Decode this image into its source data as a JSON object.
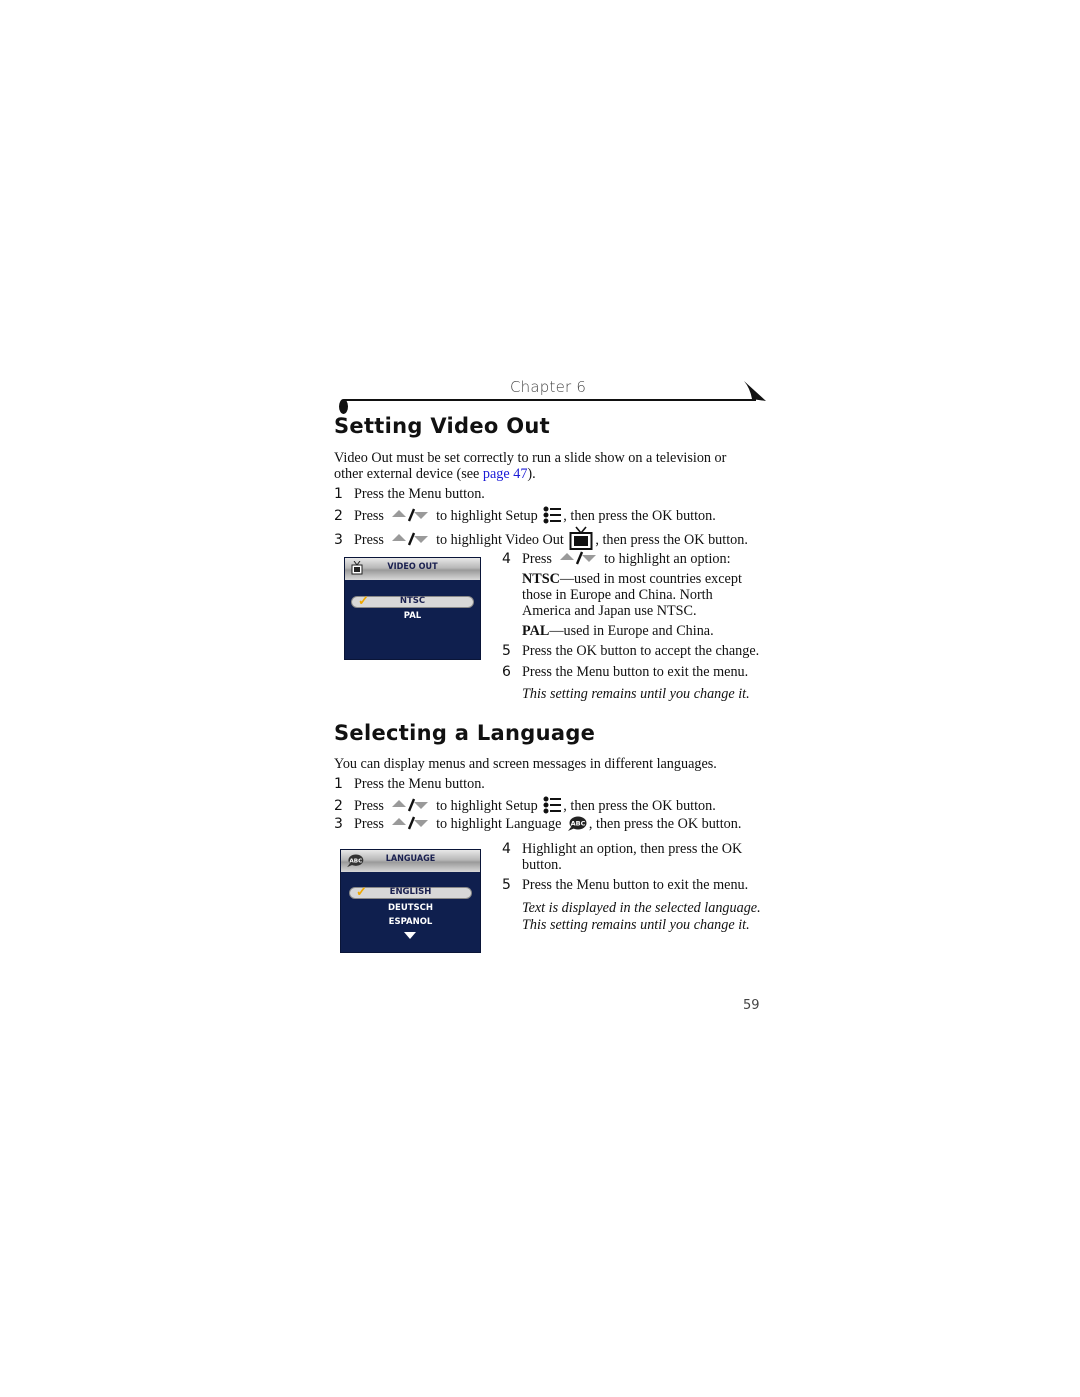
{
  "header": {
    "chapter": "Chapter 6"
  },
  "section1": {
    "title": "Setting Video Out",
    "intro_pre": "Video Out must be set correctly to run a slide show on a television or other external device (see ",
    "intro_link": "page 47",
    "intro_post": ").",
    "steps": [
      {
        "num": "1",
        "text": "Press the Menu button."
      },
      {
        "num": "2",
        "pre": "Press",
        "mid": "to highlight Setup",
        "post": ", then press the OK button."
      },
      {
        "num": "3",
        "pre": "Press",
        "mid": "to highlight Video Out",
        "post": ", then press the OK button."
      },
      {
        "num": "4",
        "pre": "Press",
        "mid": "to highlight an option:"
      },
      {
        "num": "5",
        "text": "Press the OK button to accept the change."
      },
      {
        "num": "6",
        "text": "Press the Menu button to exit the menu."
      }
    ],
    "options": [
      {
        "name": "NTSC",
        "desc": "—used in most countries except those in Europe and China. North America and Japan use NTSC."
      },
      {
        "name": "PAL",
        "desc": "—used in Europe and China."
      }
    ],
    "note": "This setting remains until you change it.",
    "screen": {
      "title": "VIDEO OUT",
      "icon": "tv-icon",
      "items": [
        "NTSC",
        "PAL"
      ],
      "selected": "NTSC"
    }
  },
  "section2": {
    "title": "Selecting a Language",
    "intro": "You can display menus and screen messages in different languages.",
    "steps": [
      {
        "num": "1",
        "text": "Press the Menu button."
      },
      {
        "num": "2",
        "pre": "Press",
        "mid": "to highlight Setup",
        "post": ", then press the OK button."
      },
      {
        "num": "3",
        "pre": "Press",
        "mid": "to highlight Language",
        "post": ", then press the OK button."
      },
      {
        "num": "4",
        "text": "Highlight an option, then press the OK",
        "text2": "button."
      },
      {
        "num": "5",
        "text": "Press the Menu button to exit the menu."
      }
    ],
    "note1": "Text is displayed in the selected language.",
    "note2": "This setting remains until you change it.",
    "screen": {
      "title": "LANGUAGE",
      "icon": "abc-speech-icon",
      "items": [
        "ENGLISH",
        "DEUTSCH",
        "ESPANOL"
      ],
      "selected": "ENGLISH"
    }
  },
  "footer": {
    "page_number": "59"
  }
}
